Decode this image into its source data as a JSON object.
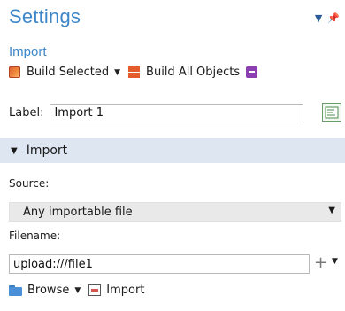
{
  "header": {
    "title": "Settings",
    "subtitle": "Import"
  },
  "toolbar": {
    "build_selected_label": "Build Selected",
    "build_all_label": "Build All Objects"
  },
  "label_field": {
    "label": "Label:",
    "value": "Import 1"
  },
  "section": {
    "title": "Import",
    "expanded": true
  },
  "source": {
    "label": "Source:",
    "selected": "Any importable file"
  },
  "filename": {
    "label": "Filename:",
    "value": "upload:///file1",
    "plus": "+"
  },
  "bottom_bar": {
    "browse_label": "Browse",
    "import_label": "Import"
  },
  "colors": {
    "accent": "#3d87c9",
    "section_bg": "#dde6f1",
    "select_bg": "#e9e9e9"
  }
}
